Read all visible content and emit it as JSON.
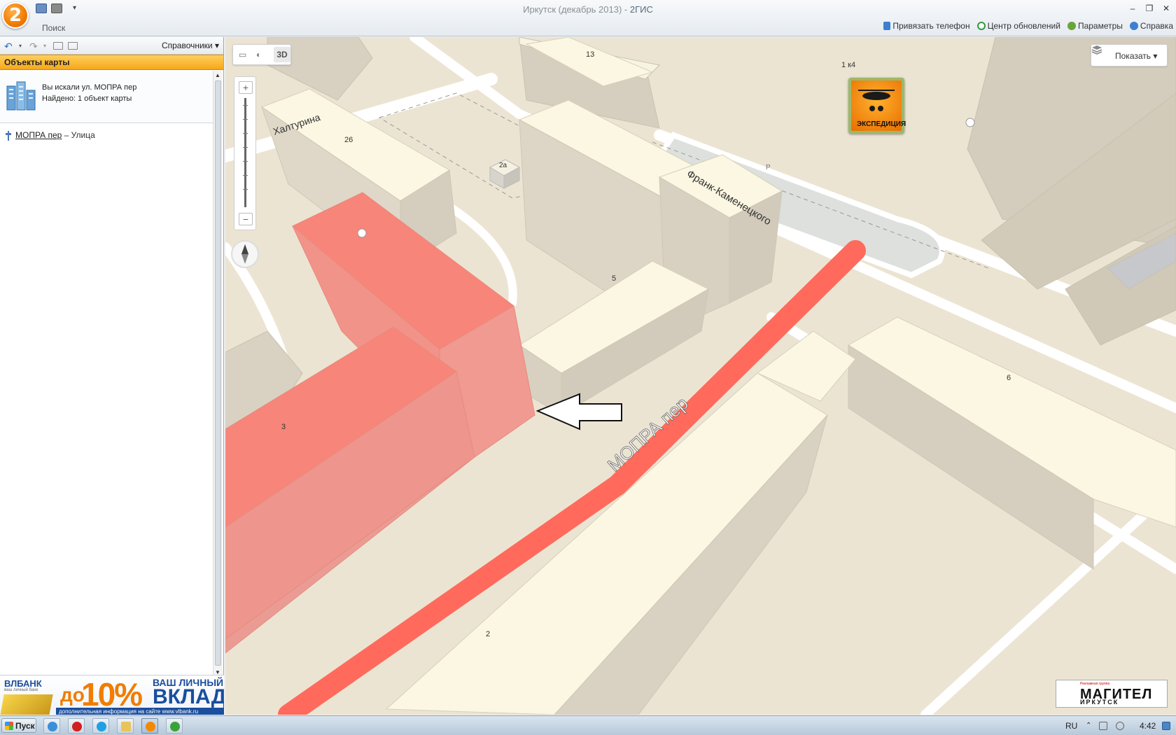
{
  "window": {
    "title": "Иркутск (декабрь 2013) - ",
    "brand": "2ГИС",
    "app_logo": "2",
    "tab_search": "Поиск",
    "minimize": "–",
    "restore": "❐",
    "close": "✕"
  },
  "top_links": {
    "phone": "Привязать телефон",
    "updates": "Центр обновлений",
    "settings": "Параметры",
    "help": "Справка"
  },
  "left_panel": {
    "directories_label": "Справочники",
    "header": "Объекты карты",
    "search_line1": "Вы искали ул. МОПРА пер",
    "search_line2": "Найдено: 1 объект карты",
    "result_name": "МОПРА пер",
    "result_type": " – Улица"
  },
  "ad": {
    "logo": "ВЛБАНК",
    "logo_sub": "ваш личный банк",
    "do": "до",
    "percent": "10%",
    "line1": "ВАШ ЛИЧНЫЙ",
    "line2": "ВКЛАД",
    "bottom": "дополнительная информация на сайте www.vlbank.ru"
  },
  "map": {
    "btn_3d": "3D",
    "show_label": "Показать",
    "street_main": "МОПРА пер",
    "street_khalturina": "Халтурина",
    "street_frank": "Франк-Каменецкого",
    "labels": {
      "b13": "13",
      "b26": "26",
      "b2a": "2а",
      "b5": "5",
      "b3": "3",
      "b6": "6",
      "b2": "2",
      "parking": "Р",
      "addr_1k4": "1 к4"
    },
    "expedition_label": "ЭКСПЕДИЦИЯ",
    "magitel_top": "Рекламная группа",
    "magitel_name": "МАГИТЕЛ",
    "magitel_city": "ИРКУТСК",
    "colors": {
      "highlight": "#ff6a5c",
      "building_top": "#fbf7e2",
      "building_side": "#d9d2c3",
      "ground": "#ece4d2",
      "road": "#ffffff"
    }
  },
  "taskbar": {
    "start_label": "Пуск",
    "lang": "RU",
    "time": "4:42"
  }
}
